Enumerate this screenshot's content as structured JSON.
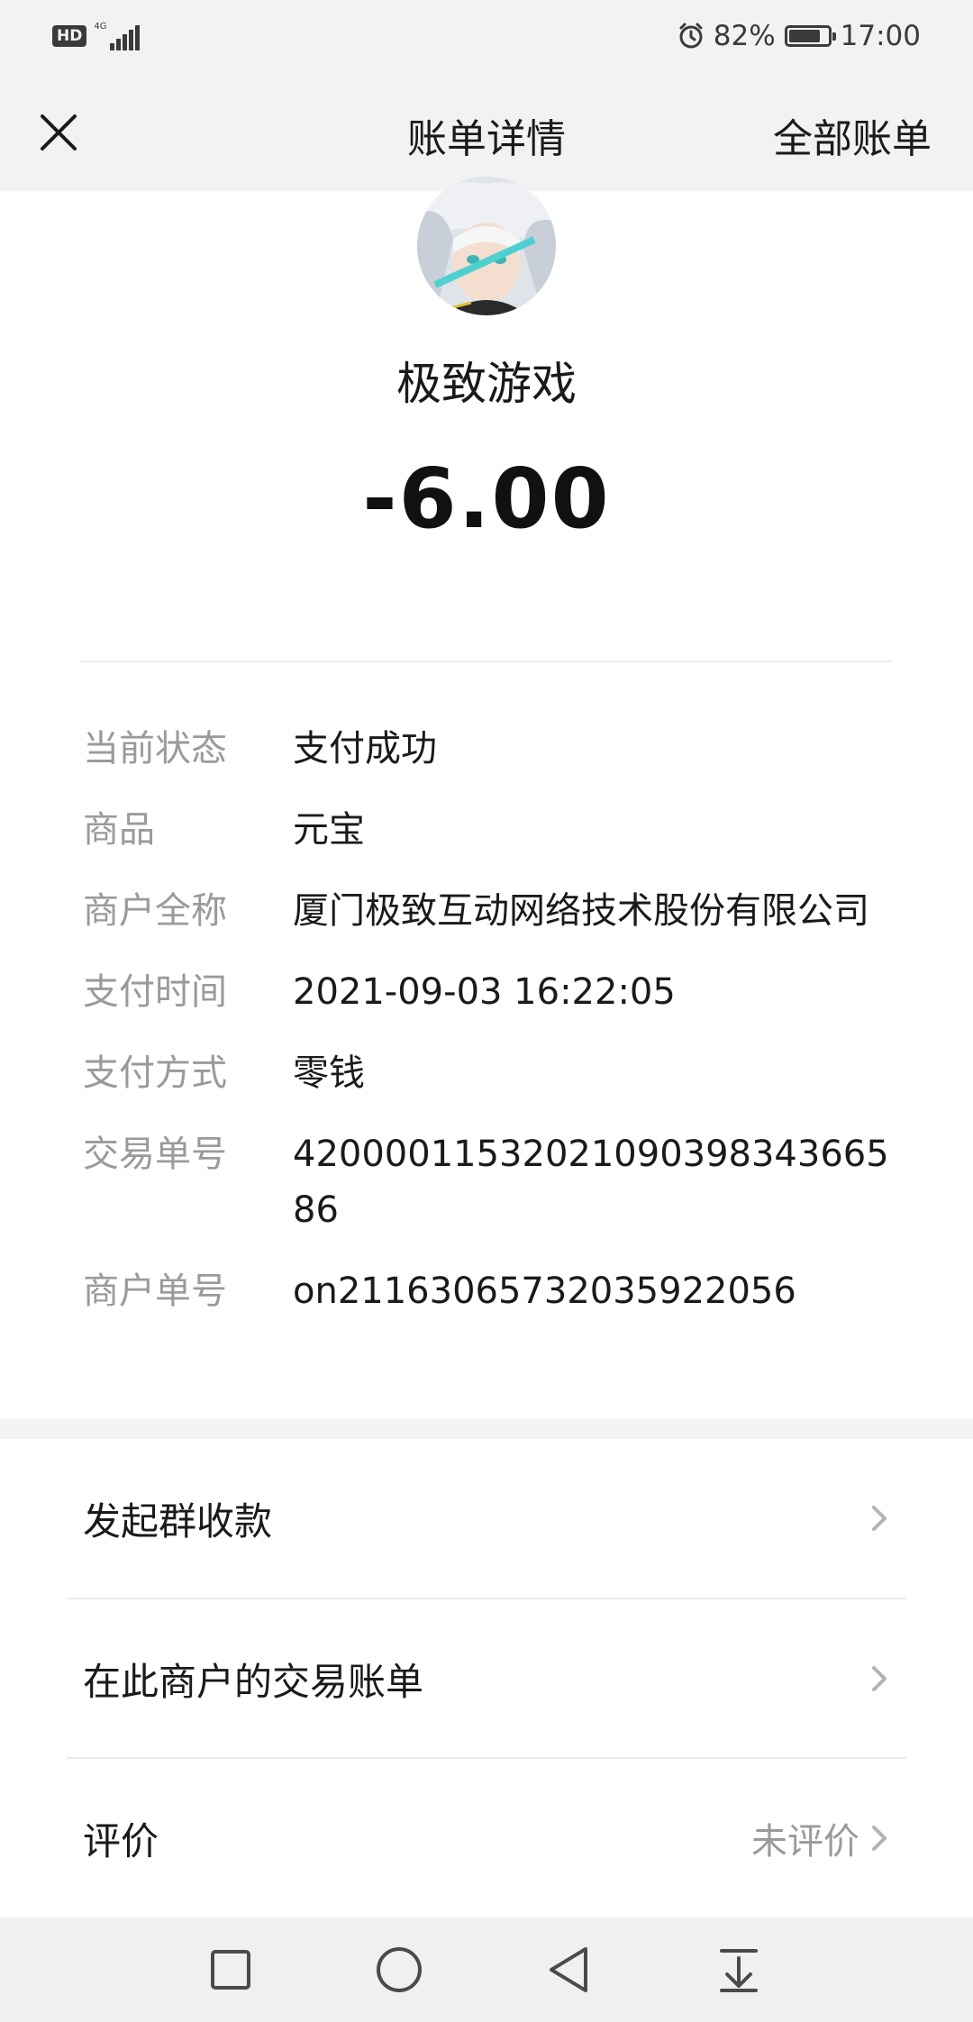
{
  "status_bar": {
    "hd": "HD",
    "network": "4G",
    "battery": "82%",
    "battery_level": 0.82,
    "time": "17:00"
  },
  "nav": {
    "title": "账单详情",
    "all_bills": "全部账单"
  },
  "header": {
    "merchant_name": "极致游戏",
    "amount": "-6.00"
  },
  "details": [
    {
      "label": "当前状态",
      "value": "支付成功"
    },
    {
      "label": "商品",
      "value": "元宝"
    },
    {
      "label": "商户全称",
      "value": "厦门极致互动网络技术股份有限公司"
    },
    {
      "label": "支付时间",
      "value": "2021-09-03 16:22:05"
    },
    {
      "label": "支付方式",
      "value": "零钱"
    },
    {
      "label": "交易单号",
      "value": "4200001153202109039834366586"
    },
    {
      "label": "商户单号",
      "value": "on21163065732035922056"
    }
  ],
  "actions": {
    "group_collect": "发起群收款",
    "merchant_bills": "在此商户的交易账单",
    "rate": "评价",
    "rate_status": "未评价"
  },
  "icons": {
    "close": "close-icon",
    "chevron": "chevron-right-icon",
    "recent": "square-icon",
    "home": "circle-icon",
    "back": "triangle-back-icon",
    "notifications": "pull-down-icon"
  }
}
